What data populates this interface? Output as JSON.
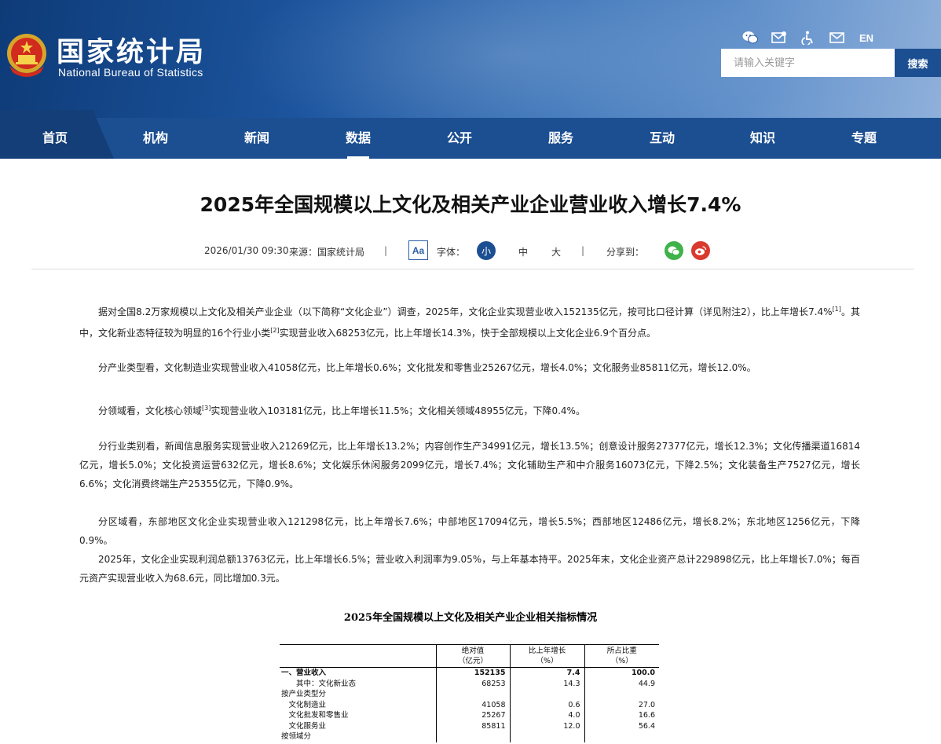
{
  "header": {
    "logo_cn": "国家统计局",
    "logo_en": "National Bureau of Statistics",
    "tools": [
      {
        "icon": "wechat-icon"
      },
      {
        "icon": "message-icon"
      },
      {
        "icon": "accessibility-icon"
      },
      {
        "icon": "mail-icon"
      }
    ],
    "lang": "EN",
    "search_placeholder": "请输入关键字",
    "search_button": "搜索"
  },
  "nav": {
    "items": [
      {
        "label": "首页"
      },
      {
        "label": "机构"
      },
      {
        "label": "新闻"
      },
      {
        "label": "数据"
      },
      {
        "label": "公开"
      },
      {
        "label": "服务"
      },
      {
        "label": "互动"
      },
      {
        "label": "知识"
      },
      {
        "label": "专题"
      }
    ],
    "active": "数据"
  },
  "article": {
    "title": "2025年全国规模以上文化及相关产业企业营业收入增长7.4%",
    "date": "2026/01/30 09:30",
    "source": "来源：国家统计局",
    "sep": "|",
    "font_icon": "Aa",
    "font_label": "字体：",
    "size_small": "小",
    "size_medium": "中",
    "size_large": "大",
    "share_label": "分享到：",
    "paragraphs": {
      "p1a": "据对全国8.2万家规模以上文化及相关产业企业（以下简称“文化企业”）调查，2025年，文化企业实现营业收入152135亿元，按可比口径计算（详见附注2），比上年增长7.4%",
      "p1_sup1": "[1]",
      "p1b": "。其中，文化新业态特征较为明显的16个行业小类",
      "p1_sup2": "[2]",
      "p1c": "实现营业收入68253亿元，比上年增长14.3%，快于全部规模以上文化企业6.9个百分点。",
      "p2": "分产业类型看，文化制造业实现营业收入41058亿元，比上年增长0.6%；文化批发和零售业25267亿元，增长4.0%；文化服务业85811亿元，增长12.0%。",
      "p3a": "分领域看，文化核心领域",
      "p3_sup": "[3]",
      "p3b": "实现营业收入103181亿元，比上年增长11.5%；文化相关领域48955亿元，下降0.4%。",
      "p4": "分行业类别看，新闻信息服务实现营业收入21269亿元，比上年增长13.2%；内容创作生产34991亿元，增长13.5%；创意设计服务27377亿元，增长12.3%；文化传播渠道16814亿元，增长5.0%；文化投资运营632亿元，增长8.6%；文化娱乐休闲服务2099亿元，增长7.4%；文化辅助生产和中介服务16073亿元，下降2.5%；文化装备生产7527亿元，增长6.6%；文化消费终端生产25355亿元，下降0.9%。",
      "p5": "分区域看，东部地区文化企业实现营业收入121298亿元，比上年增长7.6%；中部地区17094亿元，增长5.5%；西部地区12486亿元，增长8.2%；东北地区1256亿元，下降0.9%。",
      "p6": "2025年，文化企业实现利润总额13763亿元，比上年增长6.5%；营业收入利润率为9.05%，与上年基本持平。2025年末，文化企业资产总计229898亿元，比上年增长7.0%；每百元资产实现营业收入为68.6元，同比增加0.3元。"
    }
  },
  "table": {
    "title": "2025年全国规模以上文化及相关产业企业相关指标情况",
    "headers": {
      "c1a": "绝对值",
      "c1b": "（亿元）",
      "c2a": "比上年增长",
      "c2b": "（%）",
      "c3a": "所占比重",
      "c3b": "（%）"
    },
    "rows": [
      {
        "name": "一、营业收入",
        "v1": "152135",
        "v2": "7.4",
        "v3": "100.0"
      },
      {
        "name": "　　其中：文化新业态",
        "v1": "68253",
        "v2": "14.3",
        "v3": "44.9"
      },
      {
        "name": "按产业类型分",
        "v1": "",
        "v2": "",
        "v3": ""
      },
      {
        "name": "　文化制造业",
        "v1": "41058",
        "v2": "0.6",
        "v3": "27.0"
      },
      {
        "name": "　文化批发和零售业",
        "v1": "25267",
        "v2": "4.0",
        "v3": "16.6"
      },
      {
        "name": "　文化服务业",
        "v1": "85811",
        "v2": "12.0",
        "v3": "56.4"
      },
      {
        "name": "按领域分",
        "v1": "",
        "v2": "",
        "v3": ""
      }
    ]
  }
}
